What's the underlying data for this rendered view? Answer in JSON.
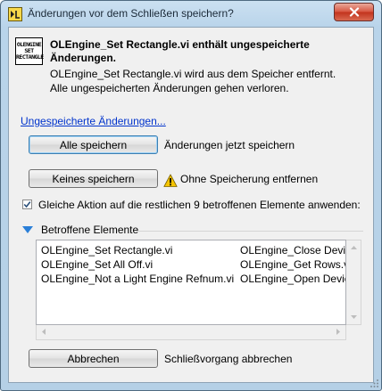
{
  "window": {
    "title": "Änderungen vor dem Schließen speichern?"
  },
  "message": {
    "bold_line1": "OLEngine_Set Rectangle.vi enthält ungespeicherte",
    "bold_line2": "Änderungen.",
    "line1": "OLEngine_Set Rectangle.vi wird aus dem Speicher entfernt.",
    "line2": "Alle ungespeicherten Änderungen gehen verloren.",
    "vi_icon_text": [
      "OLENGINE",
      "SET",
      "RECTANGLE"
    ]
  },
  "link": {
    "label": "Ungespeicherte Änderungen..."
  },
  "actions": {
    "save_all_label": "Alle speichern",
    "save_all_desc": "Änderungen jetzt speichern",
    "save_none_label": "Keines speichern",
    "save_none_desc": "Ohne Speicherung entfernen",
    "cancel_label": "Abbrechen",
    "cancel_desc": "Schließvorgang abbrechen"
  },
  "apply_all": {
    "label": "Gleiche Aktion auf die restlichen 9 betroffenen Elemente anwenden:",
    "checked": true
  },
  "affected": {
    "title": "Betroffene Elemente",
    "col1": [
      "OLEngine_Set Rectangle.vi",
      "OLEngine_Set All Off.vi",
      "OLEngine_Not a Light Engine Refnum.vi"
    ],
    "col2": [
      "OLEngine_Close Devic",
      "OLEngine_Get Rows.vi",
      "OLEngine_Open Devic"
    ]
  },
  "colors": {
    "link": "#0033cc",
    "disclosure": "#2a7fd8",
    "warning": "#f5c400"
  }
}
